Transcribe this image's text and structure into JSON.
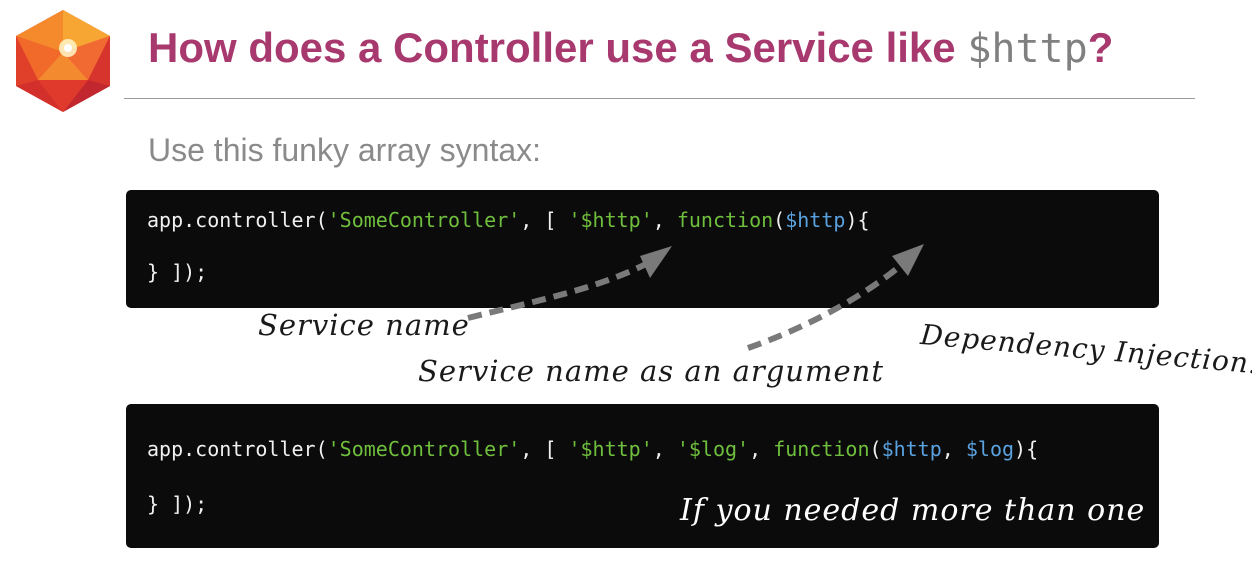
{
  "header": {
    "title_text": "How does a Controller use a Service like ",
    "title_code": "$http",
    "title_end": "?"
  },
  "subtitle": "Use this funky array syntax:",
  "code_block_1": {
    "line1": {
      "p1": "app.controller(",
      "s1": "'SomeController'",
      "p2": ", [ ",
      "s2": "'$http'",
      "p3": ", ",
      "fn": "function",
      "p4": "(",
      "a1": "$http",
      "p5": "){"
    },
    "line2": "} ]);"
  },
  "code_block_2": {
    "line1": {
      "p1": "app.controller(",
      "s1": "'SomeController'",
      "p2": ", [ ",
      "s2": "'$http'",
      "p3": ", ",
      "s3": "'$log'",
      "p4": ", ",
      "fn": "function",
      "p5": "(",
      "a1": "$http",
      "p6": ", ",
      "a2": "$log",
      "p7": "){"
    },
    "line2": "} ]);"
  },
  "annotations": {
    "service_name": "Service name",
    "service_name_arg": "Service name as an argument",
    "dependency_injection": "Dependency Injection!",
    "more_than_one": "If you needed more than one"
  },
  "colors": {
    "title": "#a8396f",
    "string": "#6fbf3d",
    "argument": "#5aa1e0",
    "code_bg": "#0b0b0b",
    "arrow": "#7a7a7a"
  },
  "icons": {
    "logo": "angular-gem-icon"
  }
}
